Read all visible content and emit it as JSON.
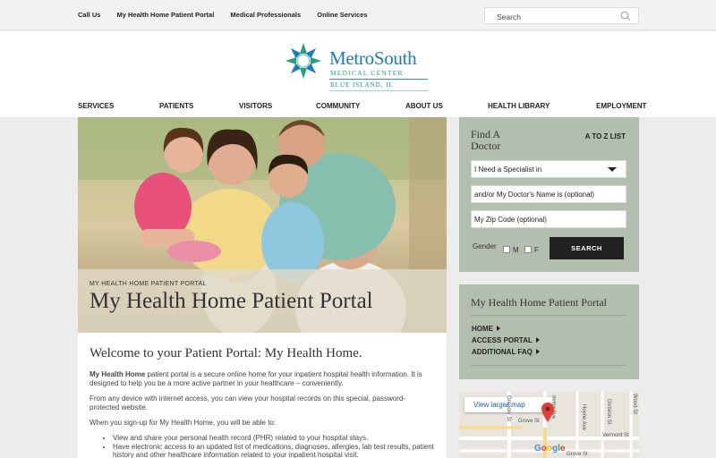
{
  "utility": {
    "links": [
      "Call Us",
      "My Health Home Patient Portal",
      "Medical Professionals",
      "Online Services"
    ],
    "search_placeholder": "Search"
  },
  "logo": {
    "name": "MetroSouth",
    "subtitle": "MEDICAL CENTER",
    "location": "BLUE ISLAND, IL"
  },
  "nav": [
    "SERVICES",
    "PATIENTS",
    "VISITORS",
    "COMMUNITY",
    "ABOUT US",
    "HEALTH LIBRARY",
    "EMPLOYMENT"
  ],
  "hero": {
    "kicker": "MY HEALTH HOME PATIENT PORTAL",
    "title": "My Health Home Patient Portal"
  },
  "article": {
    "heading": "Welcome to your Patient Portal: My Health Home.",
    "p1_strong": "My Health Home",
    "p1_rest": " patient portal is a secure online home for your inpatient hospital health information. It is designed to help you be a more active partner in your healthcare – conveniently.",
    "p2": "From any device with internet access, you can view your hospital records on this special, password-protected website.",
    "p3": "When you sign-up for My Health Home, you will be able to:",
    "bullets": [
      "View and share your personal health record (PHR) related to your hospital stays.",
      "Have electronic access to an updated list of medications, diagnoses, allergies, lab test results, patient history and other healthcare information related to your inpatient hospital visit."
    ]
  },
  "finder": {
    "title": "Find A Doctor",
    "atoz": "A TO Z LIST",
    "specialist_select": "I Need a Specialist in",
    "doctor_name_placeholder": "and/or My Doctor's Name is (optional)",
    "zip_placeholder": "My Zip Code (optional)",
    "gender_label": "Gender",
    "male": "M",
    "female": "F",
    "search_button": "SEARCH"
  },
  "portal_box": {
    "title": "My Health Home Patient Portal",
    "links": [
      "HOME",
      "ACCESS PORTAL",
      "ADDITIONAL FAQ"
    ]
  },
  "map": {
    "larger_link": "View larger map",
    "streets": [
      "Gregory St",
      "Grove St",
      "Irving Ave",
      "Hoyne Ave",
      "Division St",
      "Wood St",
      "Vermont St",
      "Grove St"
    ],
    "brand": "Google"
  }
}
